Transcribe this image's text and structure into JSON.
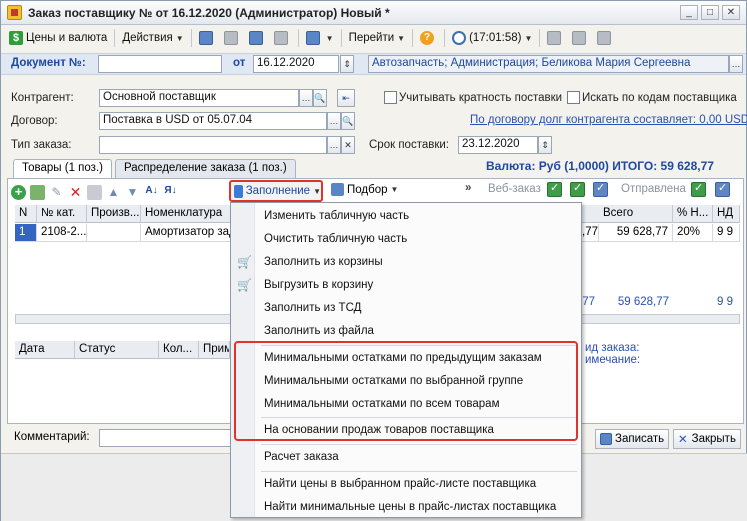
{
  "window": {
    "title": "Заказ поставщику №  от 16.12.2020 (Администратор) Новый *",
    "buttons": [
      "_",
      "□",
      "✕"
    ]
  },
  "toolbar": {
    "prices_currency": "Цены и валюта",
    "actions": "Действия",
    "goto": "Перейти",
    "time": "(17:01:58)"
  },
  "header": {
    "doc_label": "Документ №:",
    "doc_number": "",
    "date_label": "от",
    "date": "16.12.2020",
    "org_info": "Автозапчасть; Администрация; Беликова Мария Сергеевна",
    "counterparty_label": "Контрагент:",
    "counterparty": "Основной поставщик",
    "contract_label": "Договор:",
    "contract": "Поставка в USD от 05.07.04",
    "order_type_label": "Тип заказа:",
    "order_type": "",
    "check_multiplicity": "Учитывать кратность поставки",
    "search_by_codes": "Искать по кодам поставщика",
    "debt_link": "По договору долг контрагента составляет: 0,00 USD",
    "delivery_label": "Срок поставки:",
    "delivery_date": "23.12.2020"
  },
  "tabs": {
    "goods": "Товары (1 поз.)",
    "distribution": "Распределение заказа (1 поз.)"
  },
  "totals": {
    "text": "Валюта: Руб (1,0000) ИТОГО: 59 628,77"
  },
  "inner_toolbar": {
    "fill": "Заполнение",
    "select": "Подбор",
    "web_order": "Веб-заказ",
    "sent": "Отправлена"
  },
  "grid": {
    "columns": [
      "N",
      "№ кат.",
      "Произв...",
      "Номенклатура",
      "Всего",
      "% Н...",
      "НД"
    ],
    "rows": [
      {
        "n": "1",
        "cat": "2108-2...",
        "maker": "",
        "name": "Амортизатор зад",
        "partial_left": ",77",
        "total": "59 628,77",
        "vat": "20%",
        "nd": "9 9"
      }
    ],
    "total_row": {
      "partial_left": ",77",
      "total": "59 628,77",
      "nd": "9 9"
    }
  },
  "grid2": {
    "columns": [
      "Дата",
      "Статус",
      "Кол...",
      "Прим"
    ],
    "side_lines": [
      "ид заказа:",
      "имечание:"
    ]
  },
  "footer": {
    "comment_label": "Комментарий:",
    "save": "Записать",
    "close": "Закрыть"
  },
  "menu": {
    "items": [
      {
        "label": "Изменить табличную часть",
        "icon": ""
      },
      {
        "label": "Очистить табличную часть",
        "icon": ""
      },
      {
        "label": "Заполнить из корзины",
        "icon": "cart-icon"
      },
      {
        "label": "Выгрузить в корзину",
        "icon": "cart-icon"
      },
      {
        "label": "Заполнить из ТСД",
        "icon": ""
      },
      {
        "label": "Заполнить из файла",
        "icon": ""
      },
      {
        "label": "Минимальными остатками по предыдущим заказам",
        "icon": ""
      },
      {
        "label": "Минимальными остатками по выбранной группе",
        "icon": ""
      },
      {
        "label": "Минимальными остатками по всем товарам",
        "icon": ""
      },
      {
        "label": "На основании продаж товаров поставщика",
        "icon": ""
      },
      {
        "label": "Расчет заказа",
        "icon": ""
      },
      {
        "label": "Найти цены в выбранном прайс-листе поставщика",
        "icon": ""
      },
      {
        "label": "Найти минимальные цены в прайс-листах поставщика",
        "icon": ""
      }
    ]
  },
  "colors": {
    "accent_blue": "#1f48a0",
    "highlight_red": "#e0332b",
    "selection": "#3565c1"
  }
}
